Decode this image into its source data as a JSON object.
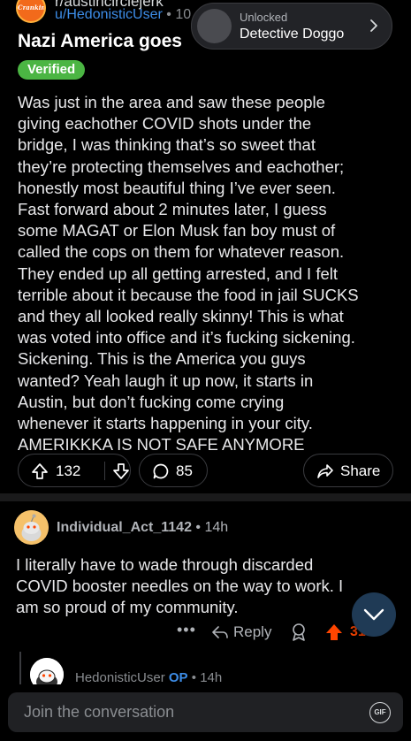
{
  "post": {
    "subreddit": "r/austincirclejerk",
    "sub_avatar_text": "Crankin",
    "author": "u/HedonisticUser",
    "separator": "•",
    "time_partial": "10",
    "title": "Nazi America  goes",
    "badge": "Verified",
    "body_lines": [
      "Was just in the area and saw these people",
      "giving eachother COVID shots under the",
      "bridge, I was thinking that’s so sweet that",
      "they’re protecting themselves and eachother;",
      "honestly most beautiful thing I’ve ever seen.",
      "Fast forward about 2 minutes later, I guess",
      "some MAGAT or Elon Musk fan boy must of",
      "called the cops on them for whatever reason.",
      "They ended up all getting arrested, and I felt",
      "terrible about it because the food in jail SUCKS",
      "and they all looked really skinny! This is what",
      "was voted into office and it’s fucking sickening.",
      "Sickening. This is the America you guys",
      "wanted? Yeah laugh it up now, it starts in",
      "Austin, but don’t fucking come crying",
      "whenever it starts happening in your city.",
      "AMERIKKKA IS NOT SAFE ANYMORE"
    ],
    "upvotes": "132",
    "comments": "85",
    "share_label": "Share"
  },
  "toast": {
    "small": "Unlocked",
    "big": "Detective Doggo"
  },
  "comment": {
    "username": "Individual_Act_1142",
    "separator": "•",
    "time": "14h",
    "body_lines": [
      "I literally have to wade through discarded",
      "COVID booster needles on the way to work. I",
      "am so proud of my community."
    ],
    "more": "•••",
    "reply_label": "Reply",
    "vote_count": "31"
  },
  "reply": {
    "username": "HedonisticUser",
    "op_tag": "OP",
    "separator": "•",
    "time": "14h"
  },
  "composer": {
    "placeholder": "Join the conversation",
    "gif_label": "GIF"
  },
  "colors": {
    "background": "#000000",
    "link_blue": "#3d8de8",
    "verified_green": "#4bb543",
    "upvote_orange": "#ff4500"
  }
}
